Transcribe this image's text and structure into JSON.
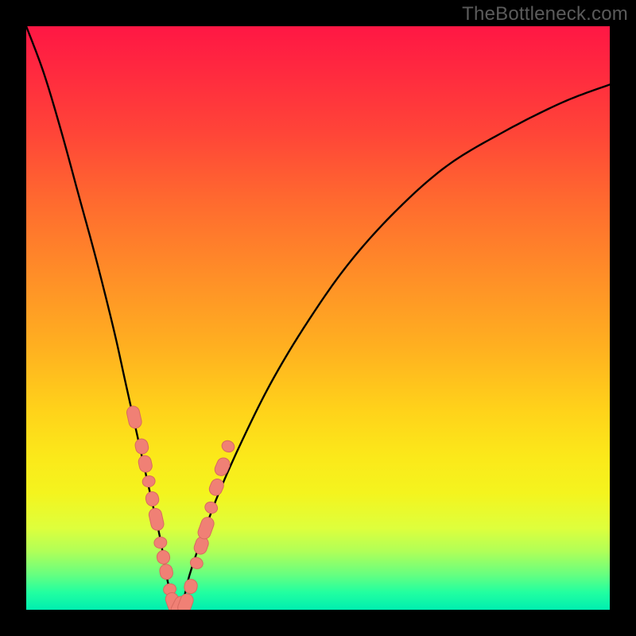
{
  "watermark": "TheBottleneck.com",
  "chart_data": {
    "type": "line",
    "title": "",
    "xlabel": "",
    "ylabel": "",
    "x_range": [
      0,
      100
    ],
    "y_range": [
      0,
      100
    ],
    "curve": {
      "note": "V-shaped bottleneck curve; values approximate percentage vs position read from plot",
      "x": [
        0,
        3,
        6,
        9,
        12,
        15,
        17,
        19,
        21,
        23,
        24,
        25,
        26,
        27,
        28,
        30,
        33,
        37,
        42,
        48,
        55,
        63,
        72,
        82,
        92,
        100
      ],
      "y": [
        100,
        92,
        82,
        71,
        60,
        48,
        39,
        30,
        21,
        12,
        6,
        2,
        0,
        2,
        6,
        12,
        20,
        29,
        39,
        49,
        59,
        68,
        76,
        82,
        87,
        90
      ]
    },
    "marker_clusters": [
      {
        "note": "left descending cluster of pink capsule markers near trough",
        "points": [
          {
            "x": 18.5,
            "y": 33
          },
          {
            "x": 19.8,
            "y": 28
          },
          {
            "x": 20.4,
            "y": 25
          },
          {
            "x": 21.0,
            "y": 22
          },
          {
            "x": 21.6,
            "y": 19
          },
          {
            "x": 22.3,
            "y": 15.5
          },
          {
            "x": 23.0,
            "y": 11.5
          },
          {
            "x": 23.5,
            "y": 9
          },
          {
            "x": 24.0,
            "y": 6.5
          },
          {
            "x": 24.6,
            "y": 3.5
          }
        ]
      },
      {
        "note": "trough markers",
        "points": [
          {
            "x": 25.2,
            "y": 1.2
          },
          {
            "x": 26.2,
            "y": 0.6
          },
          {
            "x": 27.3,
            "y": 1.0
          }
        ]
      },
      {
        "note": "right ascending cluster of pink capsule markers",
        "points": [
          {
            "x": 28.2,
            "y": 4
          },
          {
            "x": 29.2,
            "y": 8
          },
          {
            "x": 30.0,
            "y": 11
          },
          {
            "x": 30.8,
            "y": 14
          },
          {
            "x": 31.7,
            "y": 17.5
          },
          {
            "x": 32.6,
            "y": 21
          },
          {
            "x": 33.6,
            "y": 24.5
          },
          {
            "x": 34.6,
            "y": 28
          }
        ]
      }
    ],
    "colors": {
      "curve": "#000000",
      "marker_fill": "#f08075",
      "marker_stroke": "#d86a60",
      "background_top": "#ff1744",
      "background_bottom": "#00eeb0"
    }
  }
}
